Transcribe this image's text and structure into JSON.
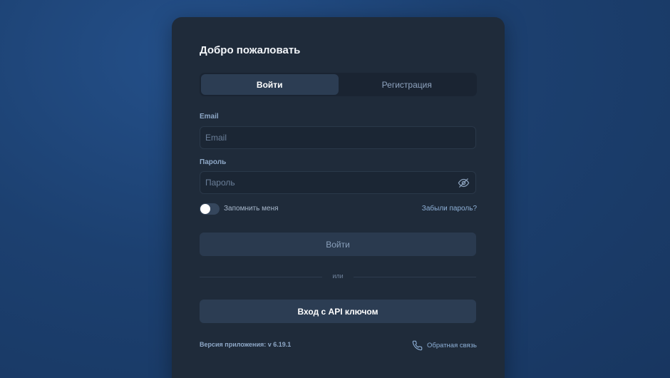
{
  "form": {
    "title": "Добро пожаловать",
    "tabs": [
      {
        "label": "Войти",
        "active": true
      },
      {
        "label": "Регистрация",
        "active": false
      }
    ],
    "email": {
      "label": "Email",
      "placeholder": "Email",
      "value": ""
    },
    "password": {
      "label": "Пароль",
      "placeholder": "Пароль",
      "value": "",
      "icon": "eye-off-icon"
    },
    "remember": {
      "label": "Запомнить меня",
      "enabled": false
    },
    "forgot_label": "Забыли пароль?",
    "login_button": "Войти",
    "or_label": "или",
    "api_button": "Вход с API ключом",
    "version_label": "Версия приложения: v 6.19.1",
    "feedback_label": "Обратная связь",
    "feedback_icon": "phone-icon"
  },
  "colors": {
    "background": "#1c4070",
    "card": "#1f2b3a",
    "accent_link": "#8eb0d7"
  }
}
